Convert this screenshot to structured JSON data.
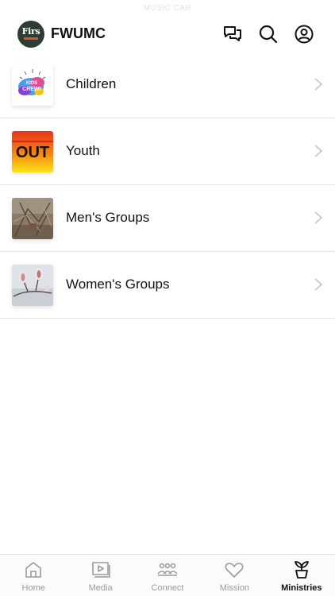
{
  "status_bar": {
    "text": "MUSIC CAR"
  },
  "header": {
    "logo_text": "Firs",
    "title": "FWUMC",
    "icons": [
      "chat-bubbles-icon",
      "search-icon",
      "profile-icon"
    ]
  },
  "ministries": [
    {
      "label": "Children",
      "thumb": "kids-crew-thumbnail"
    },
    {
      "label": "Youth",
      "thumb": "youth-out-thumbnail"
    },
    {
      "label": "Men's Groups",
      "thumb": "mens-groups-thumbnail"
    },
    {
      "label": "Women's Groups",
      "thumb": "womens-groups-thumbnail"
    }
  ],
  "thumb_text": {
    "kids": "KIDS CREW!",
    "youth": "OUT"
  },
  "tabs": [
    {
      "label": "Home",
      "icon": "home-icon"
    },
    {
      "label": "Media",
      "icon": "media-icon"
    },
    {
      "label": "Connect",
      "icon": "connect-icon"
    },
    {
      "label": "Mission",
      "icon": "heart-icon"
    },
    {
      "label": "Ministries",
      "icon": "sprout-icon",
      "active": true
    }
  ],
  "colors": {
    "accent": "#111111",
    "inactive": "#9a9a9a",
    "divider": "#e6e6e6"
  }
}
